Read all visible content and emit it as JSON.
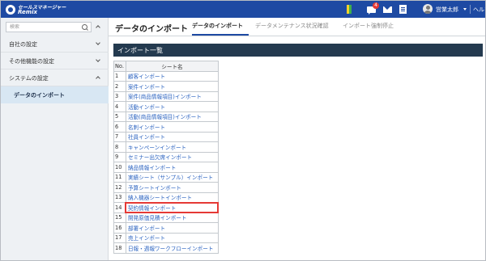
{
  "header": {
    "logo_line1": "セールスマネージャー",
    "logo_line2": "Remix",
    "chat_badge": "4",
    "user_name": "営業太郎",
    "help_label": "ヘルプ"
  },
  "sidebar": {
    "search_placeholder": "検索",
    "items": [
      {
        "label": "自社の設定"
      },
      {
        "label": "その他機能の設定"
      },
      {
        "label": "システムの設定"
      }
    ],
    "active_sub_item": "データのインポート"
  },
  "main": {
    "title": "データのインポート",
    "tabs": [
      {
        "label": "データのインポート",
        "active": true
      },
      {
        "label": "データメンテナンス状況確認",
        "active": false
      },
      {
        "label": "インポート強制停止",
        "active": false
      }
    ],
    "panel_title": "インポート一覧",
    "table": {
      "headers": {
        "no": "No.",
        "name": "シート名"
      },
      "rows": [
        {
          "no": "1",
          "name": "顧客インポート"
        },
        {
          "no": "2",
          "name": "案件インポート"
        },
        {
          "no": "3",
          "name": "案件(商品情報項目)インポート"
        },
        {
          "no": "4",
          "name": "活動インポート"
        },
        {
          "no": "5",
          "name": "活動(商品情報項目)インポート"
        },
        {
          "no": "6",
          "name": "名刺インポート"
        },
        {
          "no": "7",
          "name": "社員インポート"
        },
        {
          "no": "8",
          "name": "キャンペーンインポート"
        },
        {
          "no": "9",
          "name": "セミナー出欠席インポート"
        },
        {
          "no": "10",
          "name": "納品情報インポート"
        },
        {
          "no": "11",
          "name": "実績シート（サンプル）インポート"
        },
        {
          "no": "12",
          "name": "予算シートインポート"
        },
        {
          "no": "13",
          "name": "納入機器シートインポート"
        },
        {
          "no": "14",
          "name": "契約情報インポート",
          "highlighted": true
        },
        {
          "no": "15",
          "name": "開発原価見積インポート"
        },
        {
          "no": "16",
          "name": "部署インポート"
        },
        {
          "no": "17",
          "name": "売上インポート"
        },
        {
          "no": "18",
          "name": "日報・週報ワークフローインポート"
        }
      ]
    }
  },
  "colors": {
    "header_bg": "#1e4aa3",
    "sidebar_bg": "#eef1f4",
    "active_sub_bg": "#d8e7f3",
    "panel_header_bg": "#243a4f",
    "link": "#2b63c0",
    "highlight_border": "#e53935"
  },
  "icons": [
    "logo-icon",
    "flag-icon",
    "chat-icon",
    "mail-icon",
    "doc-icon",
    "avatar",
    "caret-icon",
    "search-icon",
    "chevron-up-icon",
    "chevron-down-icon"
  ]
}
